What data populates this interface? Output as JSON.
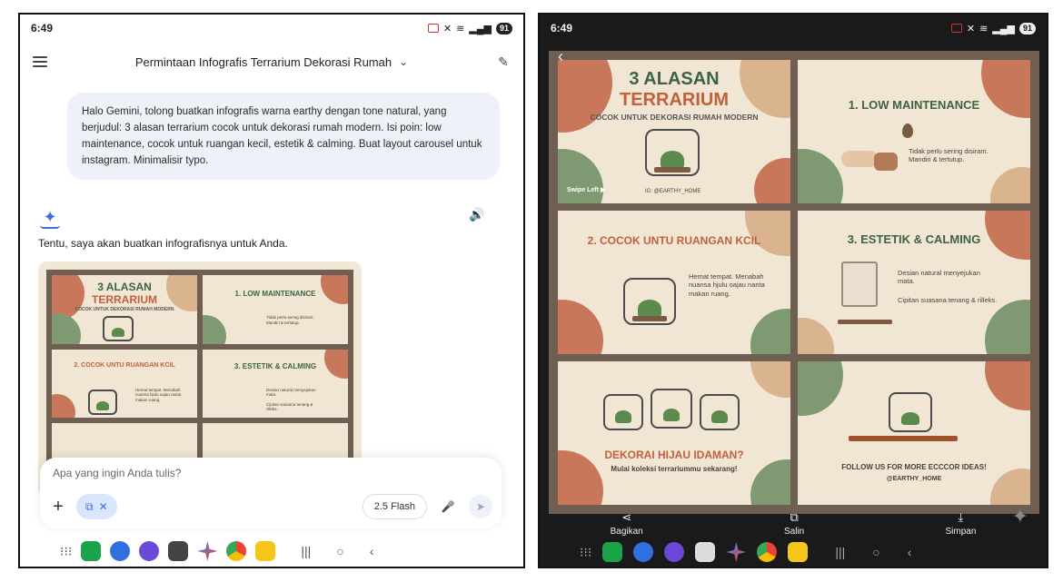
{
  "status": {
    "time": "6:49",
    "battery": "91"
  },
  "left": {
    "header_title": "Permintaan Infografis Terrarium Dekorasi Rumah",
    "user_message": "Halo Gemini, tolong buatkan infografis warna earthy dengan tone natural, yang berjudul: 3 alasan terrarium cocok untuk dekorasi rumah modern. Isi poin: low maintenance, cocok untuk ruangan kecil, estetik & calming. Buat layout carousel untuk instagram. Minimalisir typo.",
    "reply": "Tentu, saya akan buatkan infografisnya untuk Anda.",
    "input_placeholder": "Apa yang ingin Anda tulis?",
    "model_label": "2.5 Flash"
  },
  "infographic": {
    "c1_title_a": "3 ALASAN",
    "c1_title_b": "TERRARIUM",
    "c1_sub": "COCOK UNTUK DEKORASI RUMAH MODERN",
    "c1_swipe": "Swipe Left ▶",
    "c1_handle": "IG: @EARTHY_HOME",
    "c2_title": "1. LOW MAINTENANCE",
    "c2_text": "Tidak perlu sering disiram. Mandiri & tertutup.",
    "c3_title": "2. COCOK UNTU RUANGAN KCIL",
    "c3_text": "Hemat tempat. Menabah nuansa hjulu oajau nanta makan ruang.",
    "c4_title": "3. ESTETIK & CALMING",
    "c4_text_a": "Desian natural menyejukan mata.",
    "c4_text_b": "Cipitan suasana tenang & rilleks.",
    "c5_title": "DEKORAI HIJAU IDAMAN?",
    "c5_text": "Mulai koleksi terrariummu sekarang!",
    "c6_title": "FOLLOW US FOR MORE ECCCOR IDEAS!",
    "c6_handle": "@EARTHY_HOME"
  },
  "actions": {
    "share": "Bagikan",
    "copy": "Salin",
    "save": "Simpan"
  },
  "colors": {
    "terra": "#c8775a",
    "green": "#7f9a73",
    "sand": "#d9b48f",
    "frame": "#6f5f53",
    "cream": "#f1e6d3"
  }
}
